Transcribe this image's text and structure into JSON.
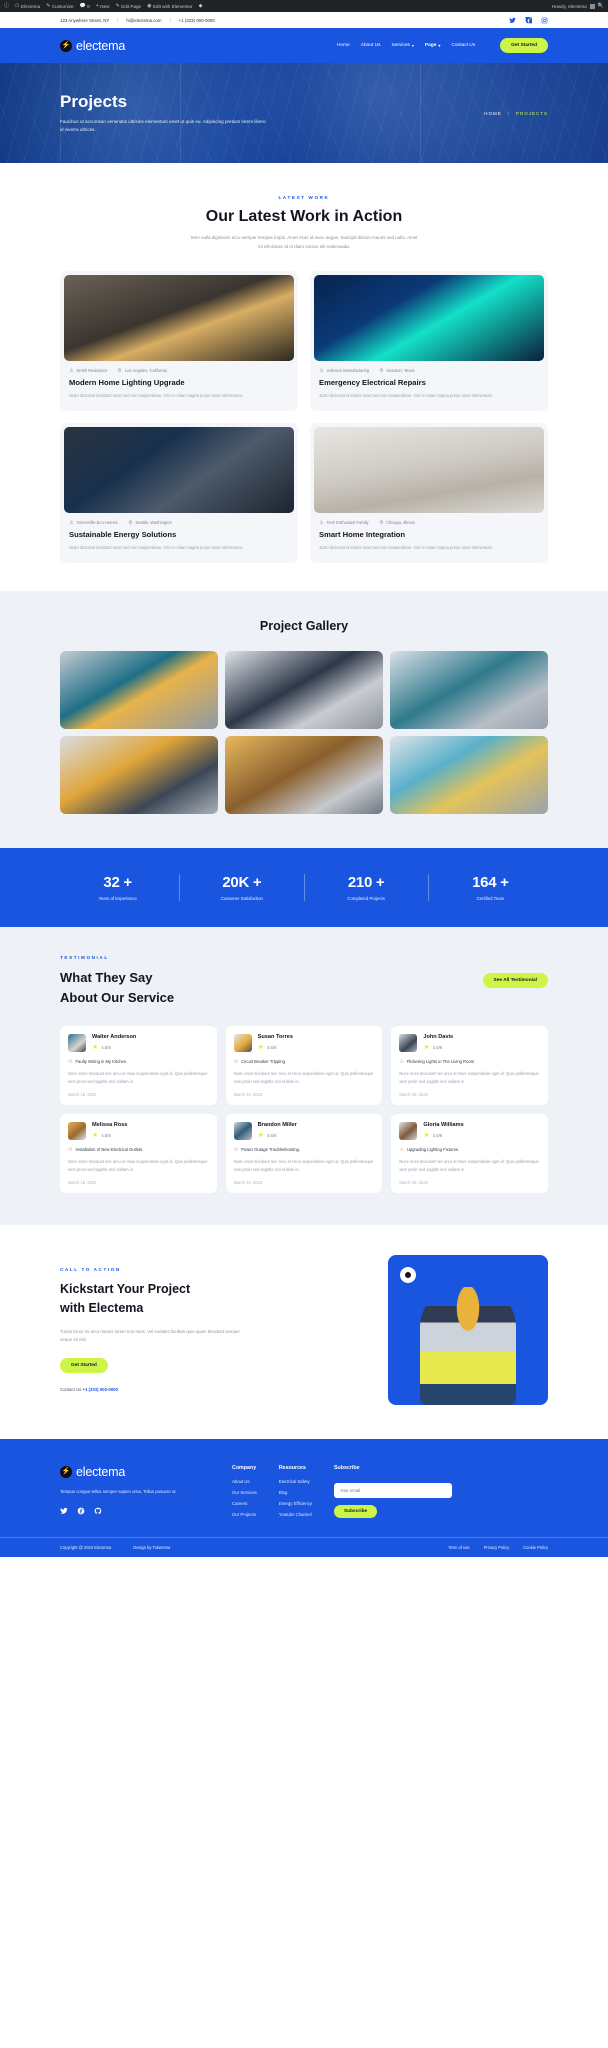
{
  "admin_bar": {
    "items": [
      "Electema",
      "Customize",
      "0",
      "New",
      "Edit Page",
      "Edit with Elementor"
    ],
    "howdy": "Howdy, electema"
  },
  "topbar": {
    "address": "123 Anywhere Street, NY",
    "email": "hi@electema.com",
    "phone": "+1 (333) 000-0000",
    "socials": [
      "twitter-icon",
      "facebook-icon",
      "instagram-icon"
    ]
  },
  "nav": {
    "brand": "electema",
    "links": [
      {
        "label": "Home",
        "caret": false,
        "active": false
      },
      {
        "label": "About Us",
        "caret": false,
        "active": false
      },
      {
        "label": "Services",
        "caret": true,
        "active": false
      },
      {
        "label": "Page",
        "caret": true,
        "active": true
      },
      {
        "label": "Contact Us",
        "caret": false,
        "active": false
      }
    ],
    "cta": "Get Started"
  },
  "hero": {
    "title": "Projects",
    "desc": "Faucibus ut accumsan venenatis ultricies elementum amet ut quis eu. Adipiscing pretium lorem libero id viverra ultrices.",
    "crumb_home": "HOME",
    "crumb_sep": "/",
    "crumb_current": "PROJECTS"
  },
  "latest": {
    "eyebrow": "LATEST WORK",
    "title": "Our Latest Work in Action",
    "subtitle": "Sem nulla dignissim arcu semper tempus turpis. Amet risus id nunc augue. Suscipit dictum mauris sed nulla. Amet mi elit donec id et diam cursus elit malesuada.",
    "cards": [
      {
        "client": "Smith Residence",
        "location": "Los Angeles, California",
        "title": "Modern Home Lighting Upgrade",
        "desc": "Justo dictumst tincidunt amet sed non suspendisse. Orci in vitae magna purus amet elementum."
      },
      {
        "client": "Johnson Manufacturing",
        "location": "Houston, Texas",
        "title": "Emergency Electrical Repairs",
        "desc": "Justo dictumst tincidunt amet sed non suspendisse. Orci in vitae magna purus amet elementum."
      },
      {
        "client": "GreenVille Eco Homes",
        "location": "Seattle, Washington",
        "title": "Sustainable Energy Solutions",
        "desc": "Justo dictumst tincidunt amet sed non suspendisse. Orci in vitae magna purus amet elementum."
      },
      {
        "client": "Tech Enthusiast Family",
        "location": "Chicago, Illinois",
        "title": "Smart Home Integration",
        "desc": "Justo dictumst tincidunt amet sed non suspendisse. Orci in vitae magna purus amet elementum."
      }
    ]
  },
  "gallery": {
    "title": "Project Gallery",
    "count": 6
  },
  "stats": [
    {
      "num": "32 +",
      "label": "Years of Experience"
    },
    {
      "num": "20K +",
      "label": "Customer Satisfaction"
    },
    {
      "num": "210 +",
      "label": "Completed Projects"
    },
    {
      "num": "164 +",
      "label": "Certified Team"
    }
  ],
  "testimonial": {
    "eyebrow": "TESTIMONIAL",
    "title_line1": "What They Say",
    "title_line2": "About Our Service",
    "cta": "See All Testimonial",
    "cards": [
      {
        "name": "Walter Anderson",
        "rating": "4.5/5",
        "issue": "Faulty Wiring in My Kitchen.",
        "body": "Nunc enim tincidunt nec arcu et risus suspendisse eget id. Quis pellentesque sem proin sed sagittis orci nullam in.",
        "date": "March 15, 2023"
      },
      {
        "name": "Susan Torres",
        "rating": "4.5/5",
        "issue": "Circuit Breaker Tripping",
        "body": "Nunc enim tincidunt nec arcu et risus suspendisse eget id. Quis pellentesque sem proin sed sagittis orci nullam in.",
        "date": "March 15, 2023"
      },
      {
        "name": "John Davis",
        "rating": "4.5/5",
        "issue": "Flickering Lights in The Living Room",
        "body": "Nunc enim tincidunt nec arcu et risus suspendisse eget id. Quis pellentesque sem proin sed sagittis orci nullam in.",
        "date": "March 15, 2023"
      },
      {
        "name": "Melissa Ross",
        "rating": "4.5/5",
        "issue": "Installation of New Electrical Outlets.",
        "body": "Nunc enim tincidunt nec arcu et risus suspendisse eget id. Quis pellentesque sem proin sed sagittis orci nullam in.",
        "date": "March 15, 2023"
      },
      {
        "name": "Brandon Miller",
        "rating": "4.5/5",
        "issue": "Power Outage Troubleshooting.",
        "body": "Nunc enim tincidunt nec arcu et risus suspendisse eget id. Quis pellentesque sem proin sed sagittis orci nullam in.",
        "date": "March 15, 2023"
      },
      {
        "name": "Gloria Williams",
        "rating": "4.5/5",
        "issue": "Upgrading Lighting Fixtures.",
        "body": "Nunc enim tincidunt nec arcu et risus suspendisse eget id. Quis pellentesque sem proin sed sagittis orci nullam in.",
        "date": "March 15, 2023"
      }
    ]
  },
  "cta": {
    "eyebrow": "CALL TO ACTION",
    "title_line1": "Kickstart Your Project",
    "title_line2": "with Electema",
    "desc": "Turpis lacus mi arcu mauris lorem non risus. Vel sodales facilisis quis quam tincidunt semper neque sit nisl.",
    "button": "Get Started",
    "contact_label": "Contact Us",
    "contact_phone": "+1 (333) 000-0000"
  },
  "footer": {
    "brand": "electema",
    "tagline": "Tempus congue tellus semper sapien urna. Tellus posuere ut.",
    "socials": [
      "twitter-icon",
      "facebook-icon",
      "github-icon"
    ],
    "columns": [
      {
        "title": "Company",
        "links": [
          "About Us",
          "Our Services",
          "Careers",
          "Our Projects"
        ]
      },
      {
        "title": "Resources",
        "links": [
          "Electrical Safety",
          "Blog",
          "Energy Efficiency",
          "Youtube Channel"
        ]
      }
    ],
    "subscribe": {
      "title": "Subscribe",
      "placeholder": "Your email",
      "button": "Subscribe"
    },
    "copyright": "Copyright @ 2023 Electema",
    "design": "Design by Toketema",
    "legal": [
      "Term of use",
      "Privacy Policy",
      "Cookie Policy"
    ]
  },
  "colors": {
    "brand_blue": "#1a55e0",
    "accent_lime": "#cdf546",
    "hero_dark": "#0e367f"
  }
}
